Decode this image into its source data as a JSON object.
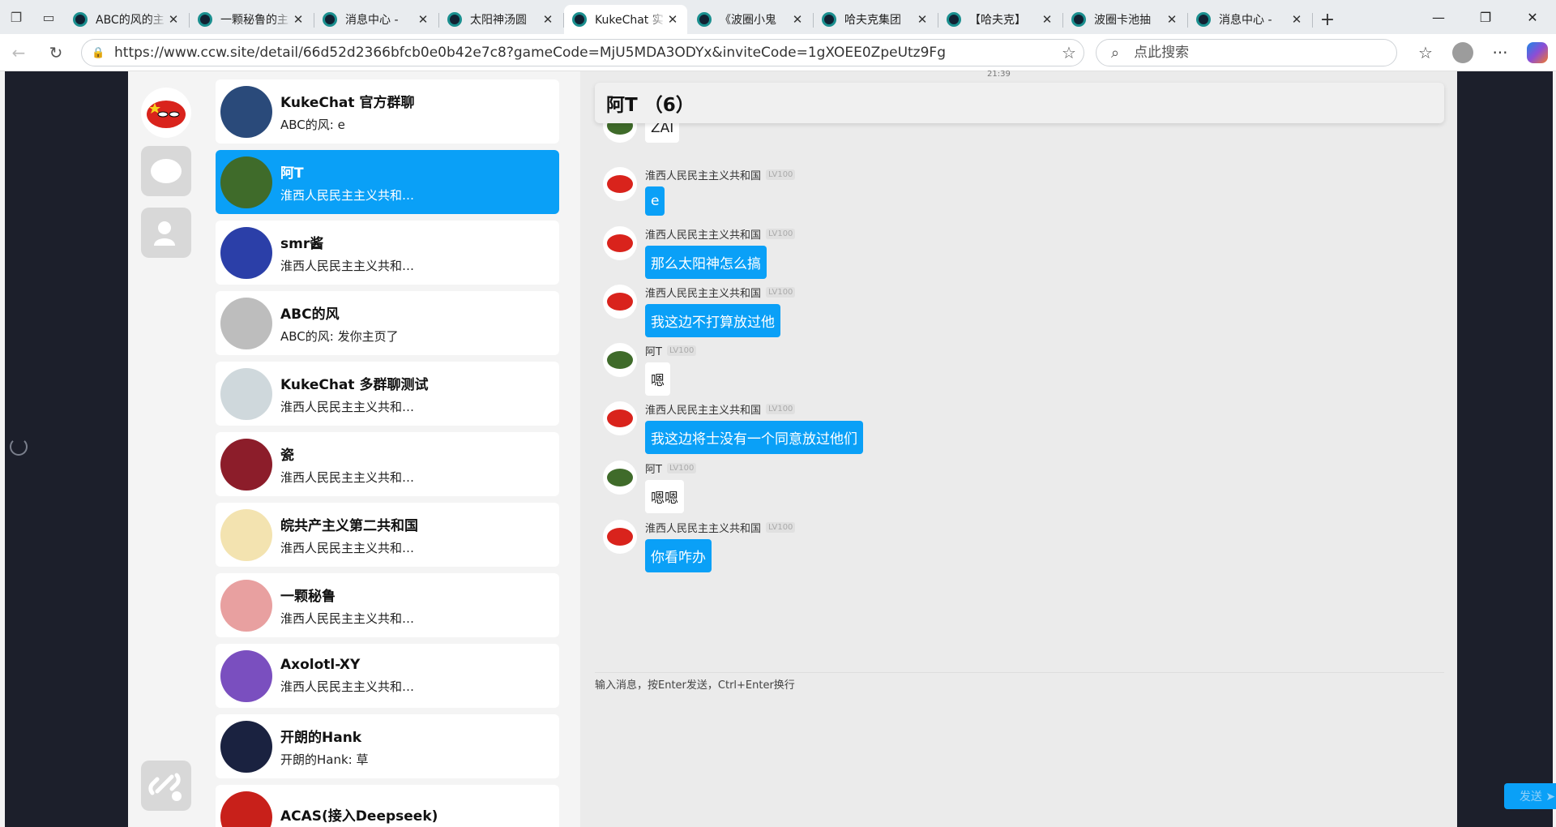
{
  "browser": {
    "tabs": [
      {
        "title": "ABC的风的主",
        "active": false
      },
      {
        "title": "一颗秘鲁的主",
        "active": false
      },
      {
        "title": "消息中心 -",
        "active": false
      },
      {
        "title": "太阳神汤圆",
        "active": false
      },
      {
        "title": "KukeChat 实",
        "active": true
      },
      {
        "title": "《波圈小鬼",
        "active": false
      },
      {
        "title": "哈夫克集团",
        "active": false
      },
      {
        "title": "【哈夫克】",
        "active": false
      },
      {
        "title": "波圈卡池抽",
        "active": false
      },
      {
        "title": "消息中心 -",
        "active": false
      }
    ],
    "url": "https://www.ccw.site/detail/66d52d2366bfcb0e0b42e7c8?gameCode=MjU5MDA3ODYx&inviteCode=1gXOEE0ZpeUtz9Fg",
    "search_placeholder": "点此搜索"
  },
  "conversations": [
    {
      "name": "KukeChat 官方群聊",
      "last": "ABC的风: e",
      "selected": false,
      "avatar_color": "#2a4a7a"
    },
    {
      "name": "阿T",
      "last": "淮西人民民主主义共和…",
      "selected": true,
      "avatar_color": "#3f6b2a"
    },
    {
      "name": "smr酱",
      "last": "淮西人民民主主义共和…",
      "selected": false,
      "avatar_color": "#2b3fa8"
    },
    {
      "name": "ABC的风",
      "last": "ABC的风: 发你主页了",
      "selected": false,
      "avatar_color": "#bdbdbd"
    },
    {
      "name": "KukeChat 多群聊测试",
      "last": "淮西人民民主主义共和…",
      "selected": false,
      "avatar_color": "#cfd8dc"
    },
    {
      "name": "瓷",
      "last": "淮西人民民主主义共和…",
      "selected": false,
      "avatar_color": "#8c1d2a"
    },
    {
      "name": "皖共产主义第二共和国",
      "last": "淮西人民民主主义共和…",
      "selected": false,
      "avatar_color": "#f3e3b0"
    },
    {
      "name": "一颗秘鲁",
      "last": "淮西人民民主主义共和…",
      "selected": false,
      "avatar_color": "#e8a0a0"
    },
    {
      "name": "Axolotl-XY",
      "last": "淮西人民民主主义共和…",
      "selected": false,
      "avatar_color": "#7a4fbf"
    },
    {
      "name": "开朗的Hank",
      "last": "开朗的Hank: 草",
      "selected": false,
      "avatar_color": "#1a2240"
    },
    {
      "name": "ACAS(接入Deepseek)",
      "last": "",
      "selected": false,
      "avatar_color": "#c8201a"
    }
  ],
  "chat": {
    "title": "阿T （6）",
    "timestamp": "21:39",
    "messages": [
      {
        "sender": "",
        "level": "",
        "text": "ZAI",
        "mine": false
      },
      {
        "sender": "淮西人民民主主义共和国",
        "level": "LV100",
        "text": "e",
        "mine": true
      },
      {
        "sender": "淮西人民民主主义共和国",
        "level": "LV100",
        "text": "那么太阳神怎么搞",
        "mine": true
      },
      {
        "sender": "淮西人民民主主义共和国",
        "level": "LV100",
        "text": "我这边不打算放过他",
        "mine": true
      },
      {
        "sender": "阿T",
        "level": "LV100",
        "text": "嗯",
        "mine": false
      },
      {
        "sender": "淮西人民民主主义共和国",
        "level": "LV100",
        "text": "我这边将士没有一个同意放过他们",
        "mine": true
      },
      {
        "sender": "阿T",
        "level": "LV100",
        "text": "嗯嗯",
        "mine": false
      },
      {
        "sender": "淮西人民民主主义共和国",
        "level": "LV100",
        "text": "你看咋办",
        "mine": true
      }
    ],
    "input_placeholder": "输入消息，按Enter发送，Ctrl+Enter换行",
    "send_label": "发送 ➤"
  },
  "colors": {
    "accent": "#0aa0f7",
    "page_bg": "#1c1f2b"
  }
}
